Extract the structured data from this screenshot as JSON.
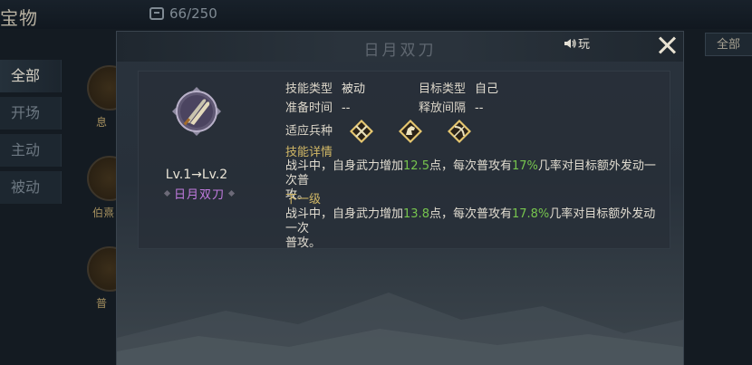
{
  "background": {
    "title": "宝物",
    "bag_count": "66/250",
    "tabs": [
      {
        "label": "全部",
        "active": true
      },
      {
        "label": "开场",
        "active": false
      },
      {
        "label": "主动",
        "active": false
      },
      {
        "label": "被动",
        "active": false
      }
    ],
    "items": [
      {
        "label": "息"
      },
      {
        "label": "伯熹"
      },
      {
        "label": "普"
      }
    ],
    "right_button": "全部"
  },
  "popup": {
    "title": "日月双刀",
    "sound_label": "玩",
    "skill": {
      "icon": "dual-blades-icon",
      "level_from": "Lv.1",
      "arrow": "→",
      "level_to": "Lv.2",
      "name": "日月双刀",
      "name_color": "#c27be0"
    },
    "fields": {
      "skill_type_label": "技能类型",
      "skill_type_value": "被动",
      "target_type_label": "目标类型",
      "target_type_value": "自己",
      "prep_time_label": "准备时间",
      "prep_time_value": "--",
      "interval_label": "释放间隔",
      "interval_value": "--",
      "unit_types_label": "适应兵种",
      "unit_icons": [
        "spear-unit-icon",
        "cavalry-unit-icon",
        "bow-unit-icon"
      ]
    },
    "detail": {
      "title": "技能详情",
      "p1": "战斗中，自身武力增加",
      "v1": "12.5",
      "p2": "点，每次普攻有",
      "v2": "17%",
      "p3": "几率对目标额外发动一次普",
      "line2": "攻。"
    },
    "next": {
      "title": "下一级",
      "p1": "战斗中，自身武力增加",
      "v1": "13.8",
      "p2": "点，每次普攻有",
      "v2": "17.8%",
      "p3": "几率对目标额外发动一次",
      "line2": "普攻。"
    },
    "colors": {
      "highlight": "#76c44e",
      "section": "#d2b866"
    }
  }
}
